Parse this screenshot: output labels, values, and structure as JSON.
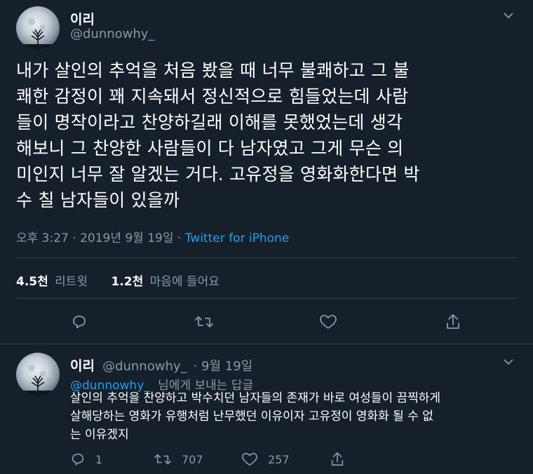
{
  "tweet": {
    "author_name": "이리",
    "author_handle": "@dunnowhy_",
    "text_lines": [
      "내가 살인의 추억을 처음 봤을 때 너무 불쾌하고 그 불",
      "쾌한 감정이 꽤 지속돼서 정신적으로 힘들었는데 사람",
      "들이 명작이라고 찬양하길래 이해를 못했었는데 생각",
      "해보니 그 찬양한 사람들이 다 남자였고 그게 무슨 의",
      "미인지 너무 잘 알겠는 거다. 고유정을 영화화한다면 박",
      "수 칠 남자들이 있을까"
    ],
    "timestamp": "오후 3:27 · 2019년 9월 19일 · ",
    "source": "Twitter for iPhone",
    "retweets_count": "4.5천",
    "retweets_label": "리트윗",
    "likes_count": "1.2천",
    "likes_label": "마음에 들어요"
  },
  "reply": {
    "author_name": "이리",
    "author_handle": "@dunnowhy_",
    "date": "· 9월 19일",
    "replying_to_handle": "@dunnowhy_",
    "replying_to_suffix": "님에게 보내는 답글",
    "text_lines": [
      "살인의 추억을 찬양하고 박수치던 남자들의 존재가 바로 여성들이 끔찍하게",
      "살해당하는 영화가 유행처럼 난무했던 이유이자 고유정이 영화화 될 수 없",
      "는 이유겠지"
    ],
    "reply_count": "1",
    "retweet_count": "707",
    "like_count": "257"
  },
  "icons": {
    "reply": "reply-icon",
    "retweet": "retweet-icon",
    "like": "heart-icon",
    "share": "share-icon",
    "more": "chevron-down-icon"
  },
  "colors": {
    "background": "#15202b",
    "secondary_text": "#8899a6",
    "link": "#1da1f2",
    "divider": "#38444d"
  }
}
